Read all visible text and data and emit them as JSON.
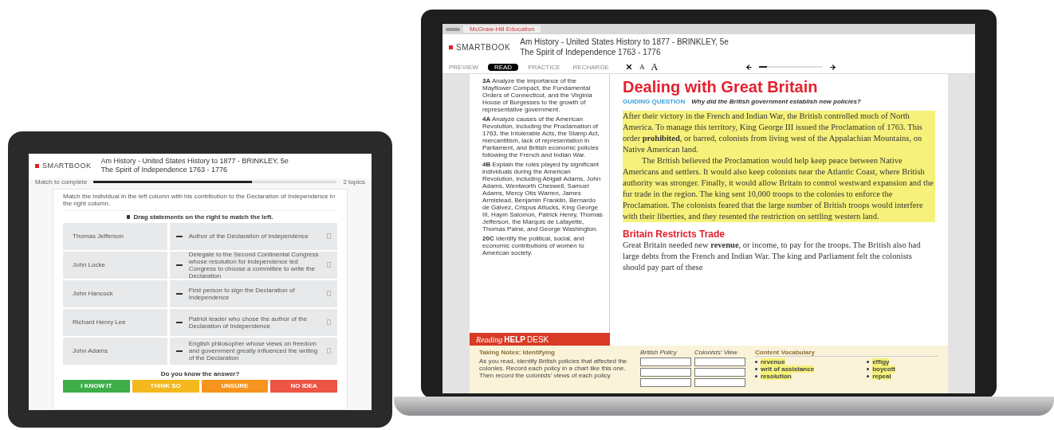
{
  "tablet": {
    "logo": "SMARTBOOK",
    "title": "Am History - United States History to 1877 - BRINKLEY, 5e",
    "subtitle": "The Spirit of Independence 1763 - 1776",
    "progress_label": "Match to complete",
    "progress": {
      "level": 0.65
    },
    "progress_caption": "2 topics",
    "prompt": "Match the individual in the left column with his contribution to the Declaration of Independence in the right column.",
    "instruction": "Drag statements on the right to match the left.",
    "pairs": [
      {
        "left": "Thomas Jefferson",
        "right": "Author of the Declaration of Independence"
      },
      {
        "left": "John Locke",
        "right": "Delegate to the Second Continental Congress whose resolution for independence led Congress to choose a committee to write the Declaration"
      },
      {
        "left": "John Hancock",
        "right": "First person to sign the Declaration of Independence"
      },
      {
        "left": "Richard Henry Lee",
        "right": "Patriot leader who chose the author of the Declaration of Independence"
      },
      {
        "left": "John Adams",
        "right": "English philosopher whose views on freedom and government greatly influenced the writing of the Declaration"
      }
    ],
    "question": "Do you know the answer?",
    "answers": [
      {
        "label": "I KNOW IT",
        "color": "#3fae4a"
      },
      {
        "label": "THINK SO",
        "color": "#f2b81c"
      },
      {
        "label": "UNSURE",
        "color": "#f7941d"
      },
      {
        "label": "NO IDEA",
        "color": "#ee5443"
      }
    ]
  },
  "laptop": {
    "browser_tab": "McGraw-Hill Education",
    "logo": "SMARTBOOK",
    "title": "Am History - United States History to 1877 - BRINKLEY, 5e",
    "subtitle": "The Spirit of Independence 1763 - 1776",
    "modes": [
      {
        "label": "PREVIEW",
        "selected": false
      },
      {
        "label": "READ",
        "selected": true
      },
      {
        "label": "PRACTICE",
        "selected": false
      },
      {
        "label": "RECHARGE",
        "selected": false
      }
    ],
    "zoom": {
      "level": 0.12
    },
    "font_small": "A",
    "font_large": "A",
    "objectives": [
      {
        "number": "3A",
        "text": "Analyze the importance of the Mayflower Compact, the Fundamental Orders of Connecticut, and the Virginia House of Burgesses to the growth of representative government."
      },
      {
        "number": "4A",
        "text": "Analyze causes of the American Revolution, including the Proclamation of 1763, the Intolerable Acts, the Stamp Act, mercantilism, lack of representation in Parliament, and British economic policies following the French and Indian War."
      },
      {
        "number": "4B",
        "text": "Explain the roles played by significant individuals during the American Revolution, including Abigail Adams, John Adams, Wentworth Cheswell, Samuel Adams, Mercy Otis Warren, James Armistead, Benjamin Franklin, Bernardo de Gálvez, Crispus Attucks, King George III, Haym Salomon, Patrick Henry, Thomas Jefferson, the Marquis de Lafayette, Thomas Paine, and George Washington."
      },
      {
        "number": "20C",
        "text": "Identify the political, social, and economic contributions of women to American society."
      }
    ],
    "heading": "Dealing with Great Britain",
    "guiding_label": "GUIDING QUESTION",
    "guiding_question": "Why did the British government establish new policies?",
    "paragraphs": [
      {
        "text": "After their victory in the French and Indian War, the British controlled much of North America. To manage this territory, King George III issued the Proclamation of 1763. This order **prohibited**, or barred, colonists from living west of the Appalachian Mountains, on Native American land.",
        "highlighted": true,
        "indent": false
      },
      {
        "text": "The British believed the Proclamation would help keep peace between Native Americans and settlers. It would also keep colonists near the Atlantic Coast, where British authority was stronger. Finally, it would allow Britain to control westward expansion and the fur trade in the region. The king sent 10,000 troops to the colonies to enforce the Proclamation. The colonists feared that the large number of British troops would interfere with their liberties, and they resented the restriction on settling western land.",
        "highlighted": true,
        "indent": true
      }
    ],
    "subheading": "Britain Restricts Trade",
    "paragraph2": "Great Britain needed new **revenue**, or income, to pay for the troops. The British also had large debts from the French and Indian War. The king and Parliament felt the colonists should pay part of these",
    "helpdesk": {
      "banner_light": "Reading",
      "banner_bold": "HELP",
      "banner_rest": "DESK",
      "notes_title": "Taking Notes: Identifying",
      "notes_text": "As you read, identify British policies that affected the colonies. Record each policy in a chart like this one. Then record the colonists' views of each policy",
      "columns": [
        "British Policy",
        "Colonists' View"
      ],
      "vocab_title": "Content Vocabulary",
      "vocab": [
        "revenue",
        "writ of assistance",
        "resolution",
        "effigy",
        "boycott",
        "repeal"
      ]
    }
  }
}
